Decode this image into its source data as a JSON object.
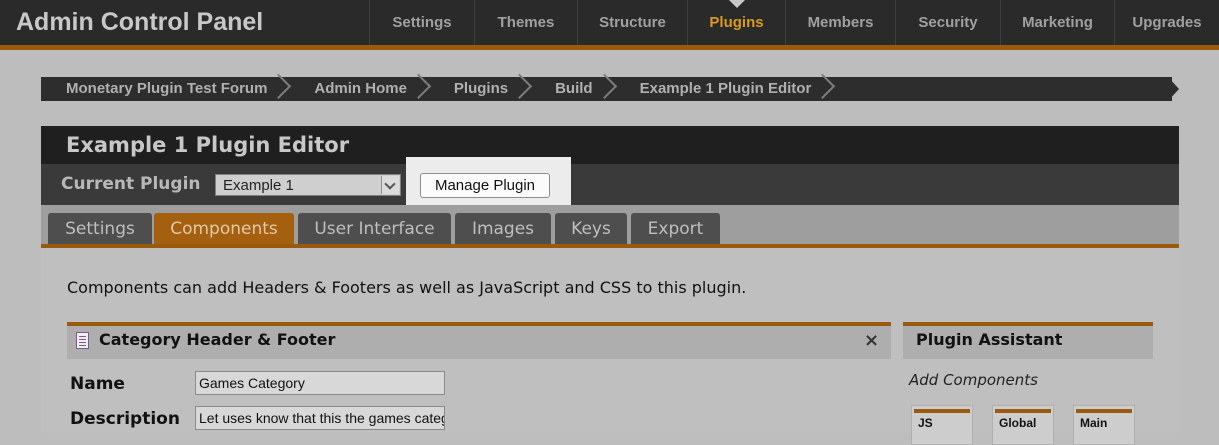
{
  "app": {
    "title": "Admin Control Panel"
  },
  "nav": {
    "items": [
      {
        "label": "Settings"
      },
      {
        "label": "Themes"
      },
      {
        "label": "Structure"
      },
      {
        "label": "Plugins",
        "active": true
      },
      {
        "label": "Members"
      },
      {
        "label": "Security"
      },
      {
        "label": "Marketing"
      },
      {
        "label": "Upgrades"
      }
    ]
  },
  "breadcrumb": [
    "Monetary Plugin Test Forum",
    "Admin Home",
    "Plugins",
    "Build",
    "Example 1 Plugin Editor"
  ],
  "panel": {
    "title": "Example 1 Plugin Editor",
    "current_plugin_label": "Current Plugin",
    "current_plugin_value": "Example 1",
    "manage_button": "Manage Plugin"
  },
  "tabs": [
    {
      "label": "Settings"
    },
    {
      "label": "Components",
      "active": true
    },
    {
      "label": "User Interface"
    },
    {
      "label": "Images"
    },
    {
      "label": "Keys"
    },
    {
      "label": "Export"
    }
  ],
  "content": {
    "intro": "Components can add Headers & Footers as well as JavaScript and CSS to this plugin.",
    "component": {
      "title": "Category Header & Footer",
      "close": "×",
      "name_label": "Name",
      "name_value": "Games Category",
      "description_label": "Description",
      "description_value": "Let uses know that this the games category"
    },
    "assistant": {
      "title": "Plugin Assistant",
      "subtitle": "Add Components",
      "cards": [
        "JS",
        "Global",
        "Main"
      ]
    }
  },
  "colors": {
    "accent": "#d99a1c",
    "accent_dark": "#9a5a0e",
    "topbar": "#2a2a2a"
  }
}
